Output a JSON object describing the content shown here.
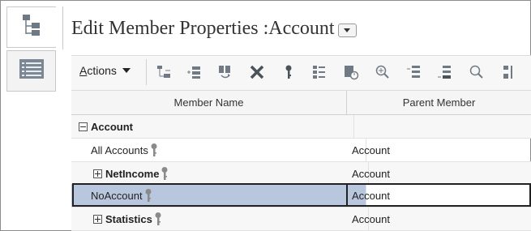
{
  "page": {
    "title": "Edit Member Properties :Account"
  },
  "rail": {
    "tabs": [
      {
        "icon": "hierarchy-tree-icon"
      },
      {
        "icon": "list-view-icon"
      }
    ]
  },
  "toolbar": {
    "actions_mnemonic": "A",
    "actions_rest": "ctions",
    "icons": [
      "add-child-icon",
      "add-sibling-icon",
      "refresh-members-icon",
      "delete-icon",
      "key-icon",
      "assign-icon",
      "history-icon",
      "zoom-in-icon",
      "move-up-icon",
      "move-down-icon",
      "search-icon",
      "more-icon"
    ]
  },
  "grid": {
    "columns": [
      "Member Name",
      "Parent Member"
    ],
    "rows": [
      {
        "name": "Account",
        "parent": "",
        "expander": "minus",
        "bold": true,
        "key": false
      },
      {
        "name": "All Accounts",
        "parent": "Account",
        "expander": "",
        "bold": false,
        "key": true
      },
      {
        "name": "NetIncome",
        "parent": "Account",
        "expander": "plus",
        "bold": true,
        "key": true
      },
      {
        "name": "NoAccount",
        "parent": "Account",
        "expander": "",
        "bold": false,
        "key": true,
        "selected": true
      },
      {
        "name": "Statistics",
        "parent": "Account",
        "expander": "plus",
        "bold": true,
        "key": true
      }
    ]
  }
}
